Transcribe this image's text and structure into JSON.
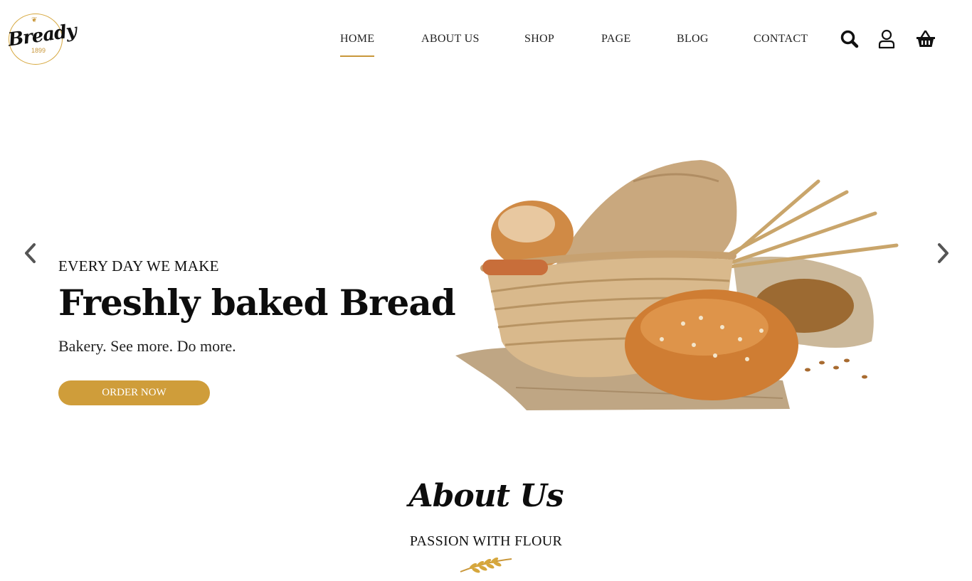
{
  "brand": {
    "name": "Bready",
    "year": "1899"
  },
  "nav": {
    "items": [
      {
        "label": "HOME",
        "active": true
      },
      {
        "label": "ABOUT US",
        "active": false
      },
      {
        "label": "SHOP",
        "active": false
      },
      {
        "label": "PAGE",
        "active": false
      },
      {
        "label": "BLOG",
        "active": false
      },
      {
        "label": "CONTACT",
        "active": false
      }
    ],
    "icons": [
      "search-icon",
      "user-icon",
      "basket-icon"
    ]
  },
  "hero": {
    "kicker": "EVERY DAY WE MAKE",
    "title": "Freshly baked Bread",
    "subtitle": "Bakery. See more. Do more.",
    "cta": "ORDER NOW"
  },
  "about": {
    "title": "About Us",
    "subtitle": "PASSION WITH FLOUR"
  },
  "colors": {
    "accent": "#cf9d3a",
    "text": "#111111",
    "background": "#ffffff"
  }
}
